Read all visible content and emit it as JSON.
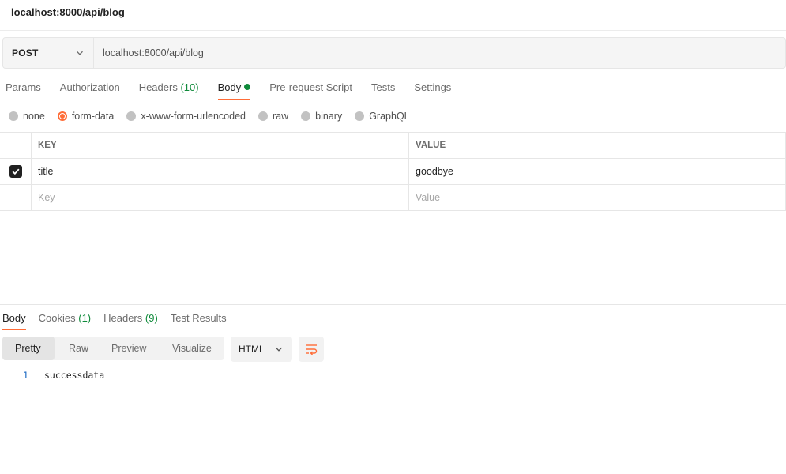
{
  "window": {
    "title": "localhost:8000/api/blog"
  },
  "request": {
    "method": "POST",
    "url": "localhost:8000/api/blog",
    "tabs": [
      {
        "label": "Params",
        "count": ""
      },
      {
        "label": "Authorization",
        "count": ""
      },
      {
        "label": "Headers",
        "count": "(10)"
      },
      {
        "label": "Body",
        "count": ""
      },
      {
        "label": "Pre-request Script",
        "count": ""
      },
      {
        "label": "Tests",
        "count": ""
      },
      {
        "label": "Settings",
        "count": ""
      }
    ],
    "active_tab": "Body",
    "body_types": [
      "none",
      "form-data",
      "x-www-form-urlencoded",
      "raw",
      "binary",
      "GraphQL"
    ],
    "selected_body_type": "form-data",
    "table": {
      "headers": {
        "key": "KEY",
        "value": "VALUE"
      },
      "rows": [
        {
          "checked": true,
          "key": "title",
          "value": "goodbye"
        }
      ],
      "placeholder": {
        "key": "Key",
        "value": "Value"
      }
    }
  },
  "response": {
    "tabs": [
      {
        "label": "Body",
        "count": ""
      },
      {
        "label": "Cookies",
        "count": "(1)"
      },
      {
        "label": "Headers",
        "count": "(9)"
      },
      {
        "label": "Test Results",
        "count": ""
      }
    ],
    "active_tab": "Body",
    "views": [
      "Pretty",
      "Raw",
      "Preview",
      "Visualize"
    ],
    "active_view": "Pretty",
    "format": "HTML",
    "lines": [
      {
        "no": "1",
        "text": "successdata"
      }
    ]
  },
  "colors": {
    "accent": "#ff6c37",
    "count_green": "#0f8a3a",
    "line_no_blue": "#1565c0"
  },
  "icons": {
    "method_dropdown": "chevron-down-icon",
    "format_dropdown": "chevron-down-icon",
    "wrap": "wrap-lines-icon",
    "checkbox": "check-icon"
  }
}
